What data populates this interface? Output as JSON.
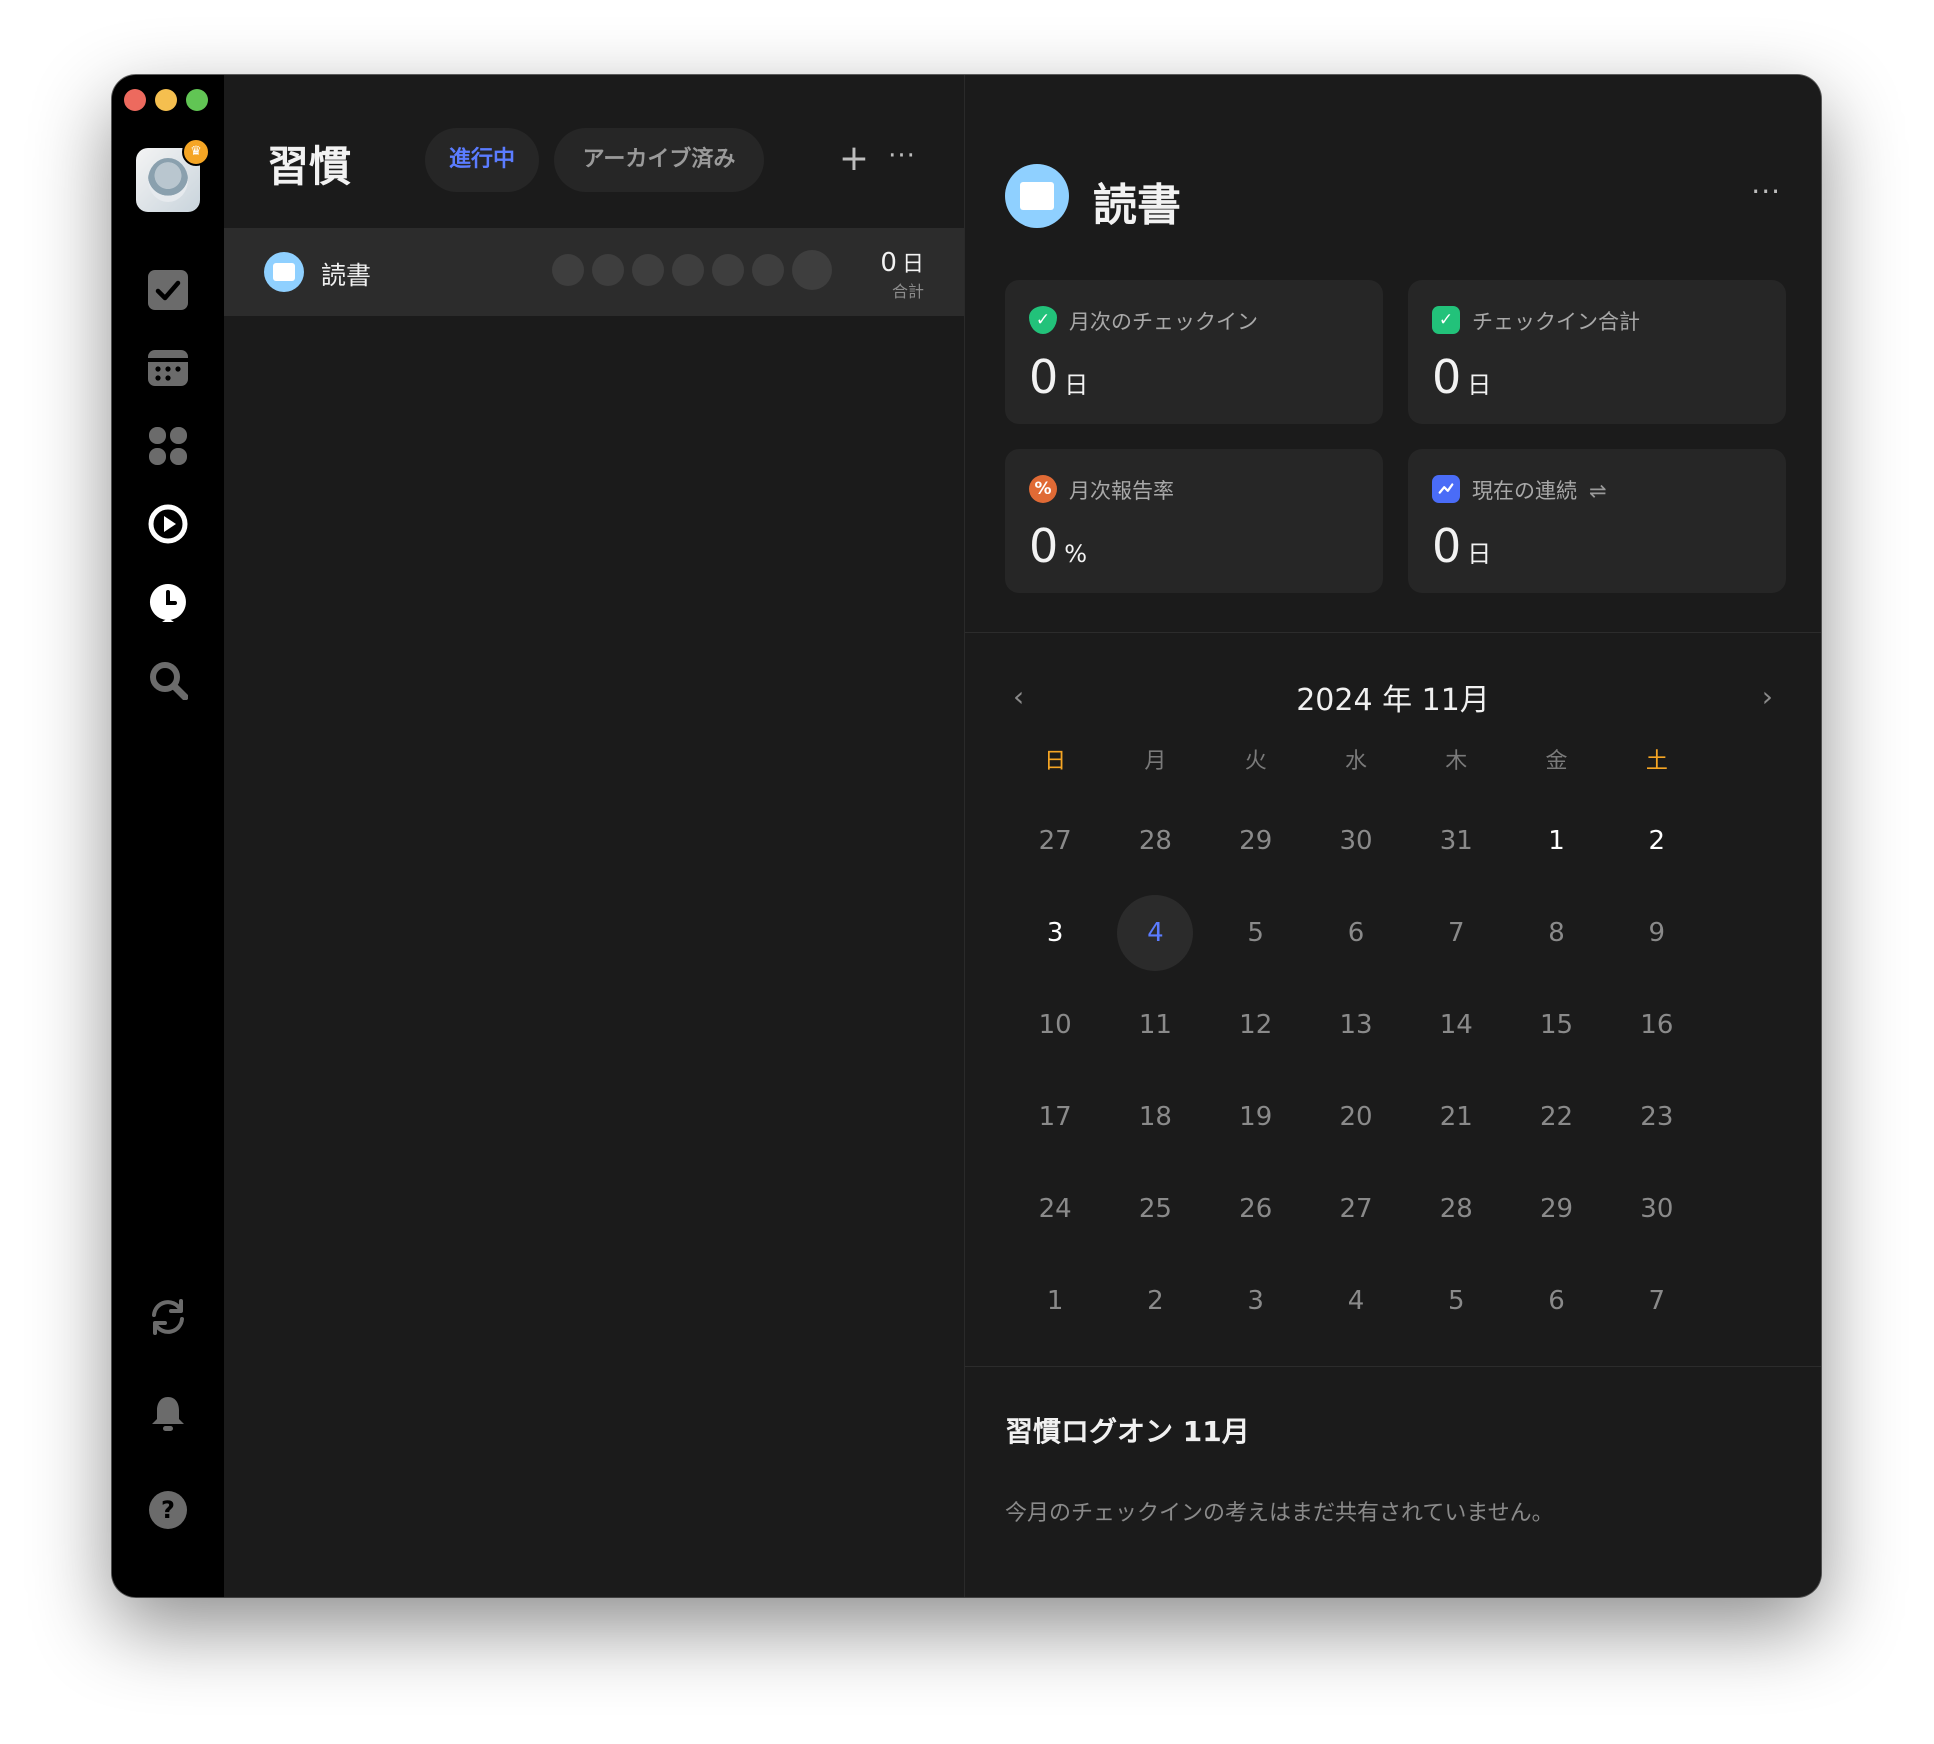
{
  "sidebar": {
    "items": [
      {
        "name": "checkbox-icon"
      },
      {
        "name": "calendar-icon"
      },
      {
        "name": "apps-grid-icon"
      },
      {
        "name": "play-circle-icon"
      },
      {
        "name": "clock-icon"
      },
      {
        "name": "search-icon"
      },
      {
        "name": "sync-icon"
      },
      {
        "name": "bell-icon"
      },
      {
        "name": "help-icon"
      }
    ]
  },
  "list": {
    "title": "習慣",
    "tabs": [
      {
        "label": "進行中",
        "active": true
      },
      {
        "label": "アーカイブ済み",
        "active": false
      }
    ],
    "add_label": "+",
    "more_label": "···",
    "habits": [
      {
        "name": "読書",
        "count": "0",
        "unit": "日",
        "count_label": "合計"
      }
    ]
  },
  "detail": {
    "title": "読書",
    "more_label": "···",
    "stats": [
      {
        "label": "月次のチェックイン",
        "value": "0",
        "unit": "日",
        "icon": "shield-check-icon",
        "color": "#22c27a"
      },
      {
        "label": "チェックイン合計",
        "value": "0",
        "unit": "日",
        "icon": "calendar-check-icon",
        "color": "#22c27a"
      },
      {
        "label": "月次報告率",
        "value": "0",
        "unit": "%",
        "icon": "percent-icon",
        "color": "#e06a35"
      },
      {
        "label": "現在の連続",
        "value": "0",
        "unit": "日",
        "icon": "trend-icon",
        "color": "#4a6cf7"
      }
    ],
    "calendar": {
      "title": "2024 年 11月",
      "weekdays": [
        "日",
        "月",
        "火",
        "水",
        "木",
        "金",
        "土"
      ],
      "weeks": [
        [
          "27",
          "28",
          "29",
          "30",
          "31",
          "1",
          "2"
        ],
        [
          "3",
          "4",
          "5",
          "6",
          "7",
          "8",
          "9"
        ],
        [
          "10",
          "11",
          "12",
          "13",
          "14",
          "15",
          "16"
        ],
        [
          "17",
          "18",
          "19",
          "20",
          "21",
          "22",
          "23"
        ],
        [
          "24",
          "25",
          "26",
          "27",
          "28",
          "29",
          "30"
        ],
        [
          "1",
          "2",
          "3",
          "4",
          "5",
          "6",
          "7"
        ]
      ],
      "today": "4"
    },
    "log": {
      "title": "習慣ログオン 11月",
      "empty_text": "今月のチェックインの考えはまだ共有されていません。"
    }
  },
  "colors": {
    "accent": "#5b7cff",
    "weekend": "#f5a524",
    "background": "#1b1b1b",
    "sidebar": "#000000"
  }
}
